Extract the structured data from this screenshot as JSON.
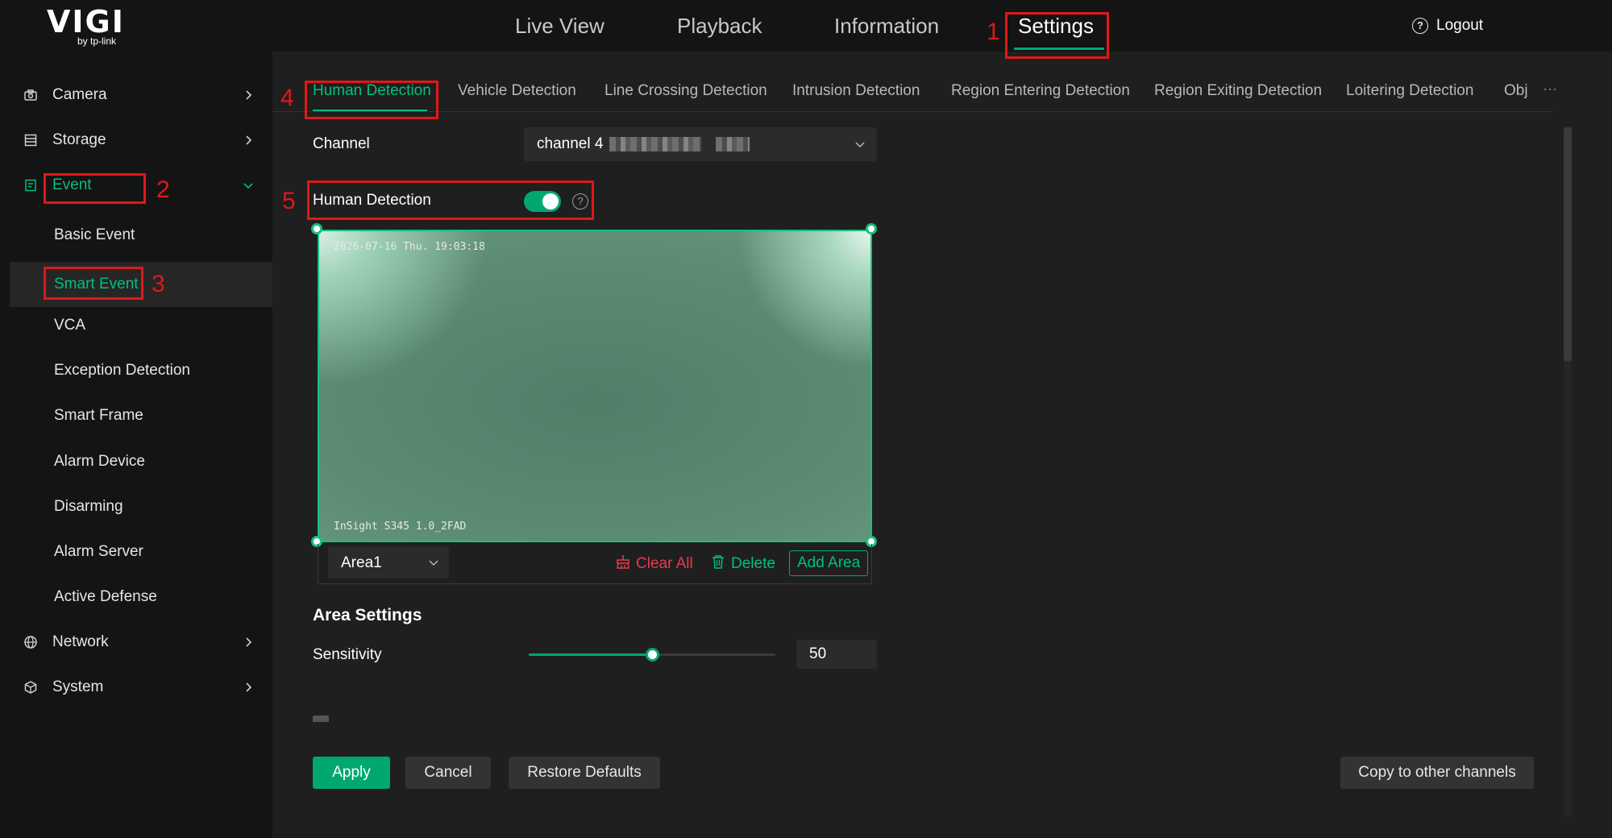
{
  "brand": {
    "logo": "VIGI",
    "logo_sub": "by tp-link"
  },
  "top_nav": {
    "items": [
      {
        "label": "Live View"
      },
      {
        "label": "Playback"
      },
      {
        "label": "Information"
      },
      {
        "label": "Settings",
        "active": true
      }
    ],
    "logout": "Logout"
  },
  "sidebar": {
    "items": [
      {
        "label": "Camera",
        "icon": "camera-icon"
      },
      {
        "label": "Storage",
        "icon": "storage-icon"
      },
      {
        "label": "Event",
        "icon": "event-icon",
        "expanded": true
      },
      {
        "label": "Basic Event"
      },
      {
        "label": "Smart Event",
        "selected": true
      },
      {
        "label": "VCA"
      },
      {
        "label": "Exception Detection"
      },
      {
        "label": "Smart Frame"
      },
      {
        "label": "Alarm Device"
      },
      {
        "label": "Disarming"
      },
      {
        "label": "Alarm Server"
      },
      {
        "label": "Active Defense"
      },
      {
        "label": "Network",
        "icon": "globe-icon"
      },
      {
        "label": "System",
        "icon": "cube-icon"
      }
    ]
  },
  "tabs": {
    "items": [
      {
        "label": "Human Detection",
        "active": true
      },
      {
        "label": "Vehicle Detection"
      },
      {
        "label": "Line Crossing Detection"
      },
      {
        "label": "Intrusion Detection"
      },
      {
        "label": "Region Entering Detection"
      },
      {
        "label": "Region Exiting Detection"
      },
      {
        "label": "Loitering Detection"
      },
      {
        "label": "Obj"
      }
    ],
    "more": "···"
  },
  "form": {
    "channel_label": "Channel",
    "channel_value": "channel 4",
    "human_detection_label": "Human Detection",
    "human_detection_enabled": true,
    "help": "?"
  },
  "video": {
    "timestamp": "2026-07-16 Thu. 19:03:18",
    "camera_name": "InSight S345 1.0_2FAD"
  },
  "area_bar": {
    "selected_area": "Area1",
    "clear_all": "Clear All",
    "delete": "Delete",
    "add_area": "Add Area"
  },
  "area_settings": {
    "title": "Area Settings",
    "sensitivity_label": "Sensitivity",
    "sensitivity_value": "50",
    "sensitivity_fraction": 0.5
  },
  "actions": {
    "apply": "Apply",
    "cancel": "Cancel",
    "restore": "Restore Defaults",
    "copy": "Copy to other channels"
  },
  "annotations": [
    "1",
    "2",
    "3",
    "4",
    "5"
  ],
  "colors": {
    "accent": "#00a870",
    "accent_text": "#00c07f",
    "danger": "#f0364f",
    "annotation": "#e01818"
  }
}
